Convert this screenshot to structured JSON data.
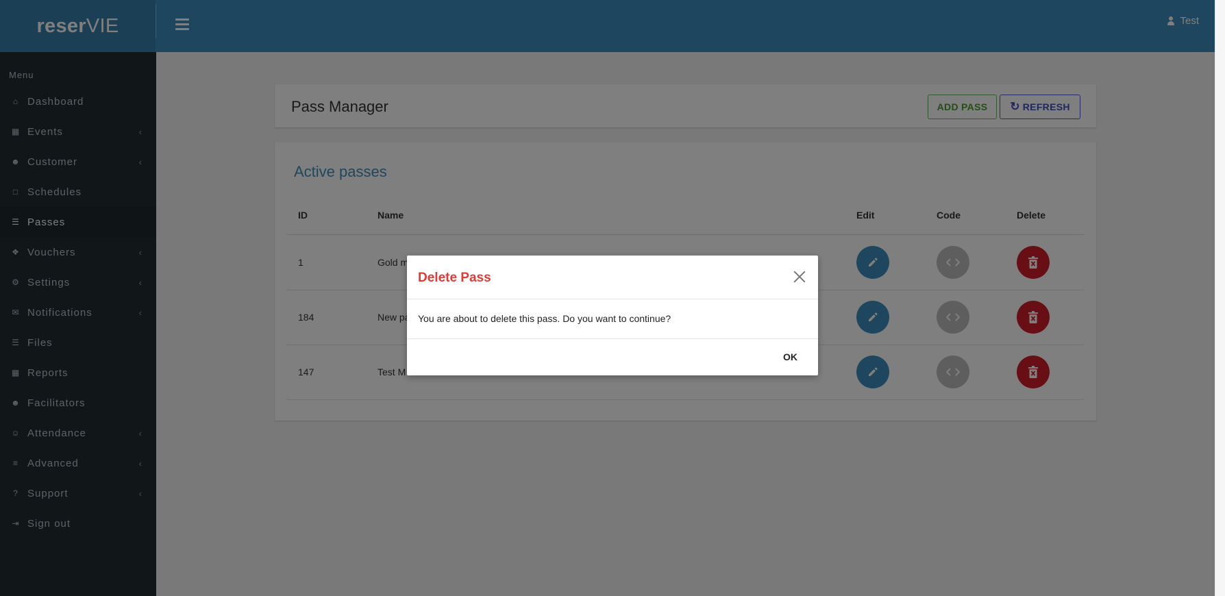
{
  "brand": {
    "bold": "reser",
    "light": "VIE"
  },
  "header": {
    "user_name": "Test",
    "menu_icon": "hamburger-icon",
    "user_icon": "user-icon"
  },
  "sidebar": {
    "menu_header": "Menu",
    "items": [
      {
        "label": "Dashboard",
        "icon": "home-icon",
        "has_submenu": false
      },
      {
        "label": "Events",
        "icon": "calendar-icon",
        "has_submenu": true
      },
      {
        "label": "Customer",
        "icon": "users-icon",
        "has_submenu": true
      },
      {
        "label": "Schedules",
        "icon": "calendar-empty-icon",
        "has_submenu": false
      },
      {
        "label": "Passes",
        "icon": "document-icon",
        "has_submenu": false,
        "active": true
      },
      {
        "label": "Vouchers",
        "icon": "gift-icon",
        "has_submenu": true
      },
      {
        "label": "Settings",
        "icon": "cogs-icon",
        "has_submenu": true
      },
      {
        "label": "Notifications",
        "icon": "envelope-icon",
        "has_submenu": true
      },
      {
        "label": "Files",
        "icon": "file-icon",
        "has_submenu": false
      },
      {
        "label": "Reports",
        "icon": "table-icon",
        "has_submenu": false
      },
      {
        "label": "Facilitators",
        "icon": "users-icon",
        "has_submenu": false
      },
      {
        "label": "Attendance",
        "icon": "user-check-icon",
        "has_submenu": true
      },
      {
        "label": "Advanced",
        "icon": "server-icon",
        "has_submenu": true
      },
      {
        "label": "Support",
        "icon": "question-circle-icon",
        "has_submenu": true
      },
      {
        "label": "Sign out",
        "icon": "sign-out-icon",
        "has_submenu": false
      }
    ]
  },
  "pass_manager": {
    "title": "Pass Manager",
    "add_label": "ADD PASS",
    "refresh_label": "REFRESH"
  },
  "active_passes": {
    "title": "Active passes",
    "columns": {
      "id": "ID",
      "name": "Name",
      "edit": "Edit",
      "code": "Code",
      "delete": "Delete"
    },
    "rows": [
      {
        "id": "1",
        "name": "Gold m"
      },
      {
        "id": "184",
        "name": "New pa"
      },
      {
        "id": "147",
        "name": "Test M"
      }
    ]
  },
  "modal": {
    "title": "Delete Pass",
    "message": "You are about to delete this pass. Do you want to continue?",
    "ok_label": "OK"
  },
  "colors": {
    "header": "#3c8dbc",
    "sidebar": "#222d32",
    "edit": "#3c8dbc",
    "code": "#bdbdbd",
    "delete": "#d01e2a",
    "modal_title": "#e53935"
  }
}
